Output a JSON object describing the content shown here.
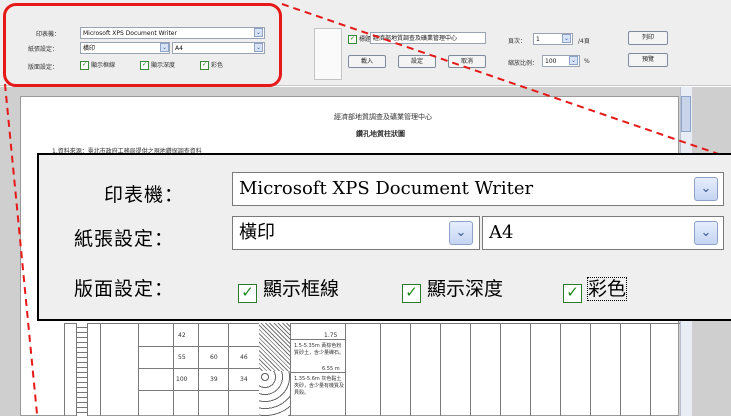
{
  "toolbar": {
    "printer_label": "印表機：",
    "printer_value": "Microsoft XPS Document Writer",
    "paper_label": "紙張設定：",
    "orientation_value": "橫印",
    "paper_size_value": "A4",
    "layout_label": "版面設定：",
    "show_frame_label": "顯示框線",
    "show_depth_label": "顯示深度",
    "color_label": "彩色",
    "header_checkbox_label": "標題",
    "header_input_value": "經濟部地質調查及礦業管理中心",
    "import_button": "載入",
    "settings_button": "設定",
    "cancel_button": "取消",
    "page_label": "頁次：",
    "page_value": "1",
    "page_suffix": "/4頁",
    "zoom_label": "縮放比例：",
    "zoom_value": "100",
    "zoom_suffix": "%",
    "print_button": "列印",
    "preview_button": "預覽"
  },
  "document": {
    "org_title": "經濟部地質調查及礦業管理中心",
    "doc_title": "鑽孔地質柱狀圖",
    "remark_line": "1.資料來源：臺北市政府工務局提供之現地鑽探調查資料",
    "depth_value": "1.75",
    "note_1": "1.5-5.35m 黃棕色粉質砂土，含少量礫石。",
    "note_2": "6.55 m",
    "note_3": "1.35-5.6m 灰色黏土夾砂，含少量有機質及貝殼。",
    "cell_values": [
      "42",
      "55",
      "60",
      "46",
      "100",
      "39",
      "34"
    ]
  },
  "zoom_panel": {
    "printer_label": "印表機：",
    "printer_value": "Microsoft XPS Document Writer",
    "paper_label": "紙張設定：",
    "orientation_value": "橫印",
    "paper_size_value": "A4",
    "layout_label": "版面設定：",
    "show_frame_label": "顯示框線",
    "show_depth_label": "顯示深度",
    "color_label": "彩色"
  }
}
